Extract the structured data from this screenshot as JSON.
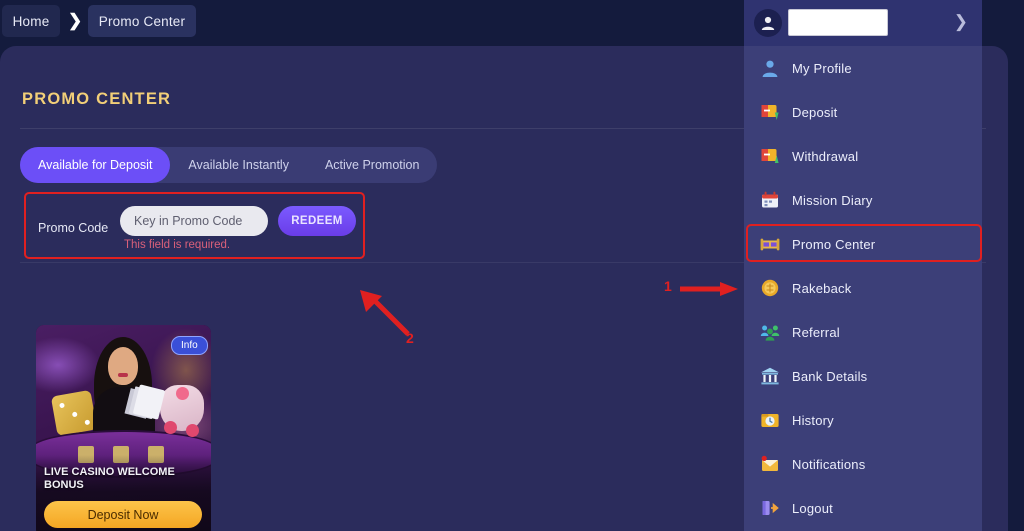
{
  "breadcrumb": {
    "home": "Home",
    "separator": "chevron-right-icon",
    "current": "Promo Center"
  },
  "panel": {
    "title": "PROMO CENTER",
    "tabs": [
      {
        "label": "Available for Deposit",
        "active": true
      },
      {
        "label": "Available Instantly",
        "active": false
      },
      {
        "label": "Active Promotion",
        "active": false
      }
    ]
  },
  "promo_code": {
    "label": "Promo Code",
    "input_value": "",
    "placeholder": "Key in Promo Code",
    "redeem_label": "REDEEM",
    "error": "This field is required."
  },
  "promo_card": {
    "info_badge": "Info",
    "title": "LIVE CASINO WELCOME BONUS",
    "cta": "Deposit Now"
  },
  "annotations": [
    {
      "number": "1",
      "target": "sidebar-item-promo-center"
    },
    {
      "number": "2",
      "target": "promo-code-row"
    }
  ],
  "sidebar": {
    "header": {
      "avatar": "user-avatar-icon",
      "username": "",
      "chevron": "chevron-right-icon"
    },
    "items": [
      {
        "label": "My Profile",
        "icon": "user-profile-icon",
        "highlighted": false
      },
      {
        "label": "Deposit",
        "icon": "deposit-icon",
        "highlighted": false
      },
      {
        "label": "Withdrawal",
        "icon": "withdrawal-icon",
        "highlighted": false
      },
      {
        "label": "Mission Diary",
        "icon": "calendar-icon",
        "highlighted": false
      },
      {
        "label": "Promo Center",
        "icon": "gift-ticket-icon",
        "highlighted": true
      },
      {
        "label": "Rakeback",
        "icon": "coin-icon",
        "highlighted": false
      },
      {
        "label": "Referral",
        "icon": "people-group-icon",
        "highlighted": false
      },
      {
        "label": "Bank Details",
        "icon": "bank-icon",
        "highlighted": false
      },
      {
        "label": "History",
        "icon": "clock-folder-icon",
        "highlighted": false
      },
      {
        "label": "Notifications",
        "icon": "mail-alert-icon",
        "highlighted": false
      },
      {
        "label": "Logout",
        "icon": "logout-door-icon",
        "highlighted": false
      }
    ]
  },
  "colors": {
    "page_background": "#141b3d",
    "panel_background": "#2b2c5c",
    "sidebar_background": "#3c3f78",
    "sidebar_header": "#2f3370",
    "accent_purple": "#6c4ff7",
    "title_gold": "#f2cf78",
    "annotation_red": "#e02020",
    "error_pink": "#d9607a",
    "cta_gold": "#f5a623"
  }
}
